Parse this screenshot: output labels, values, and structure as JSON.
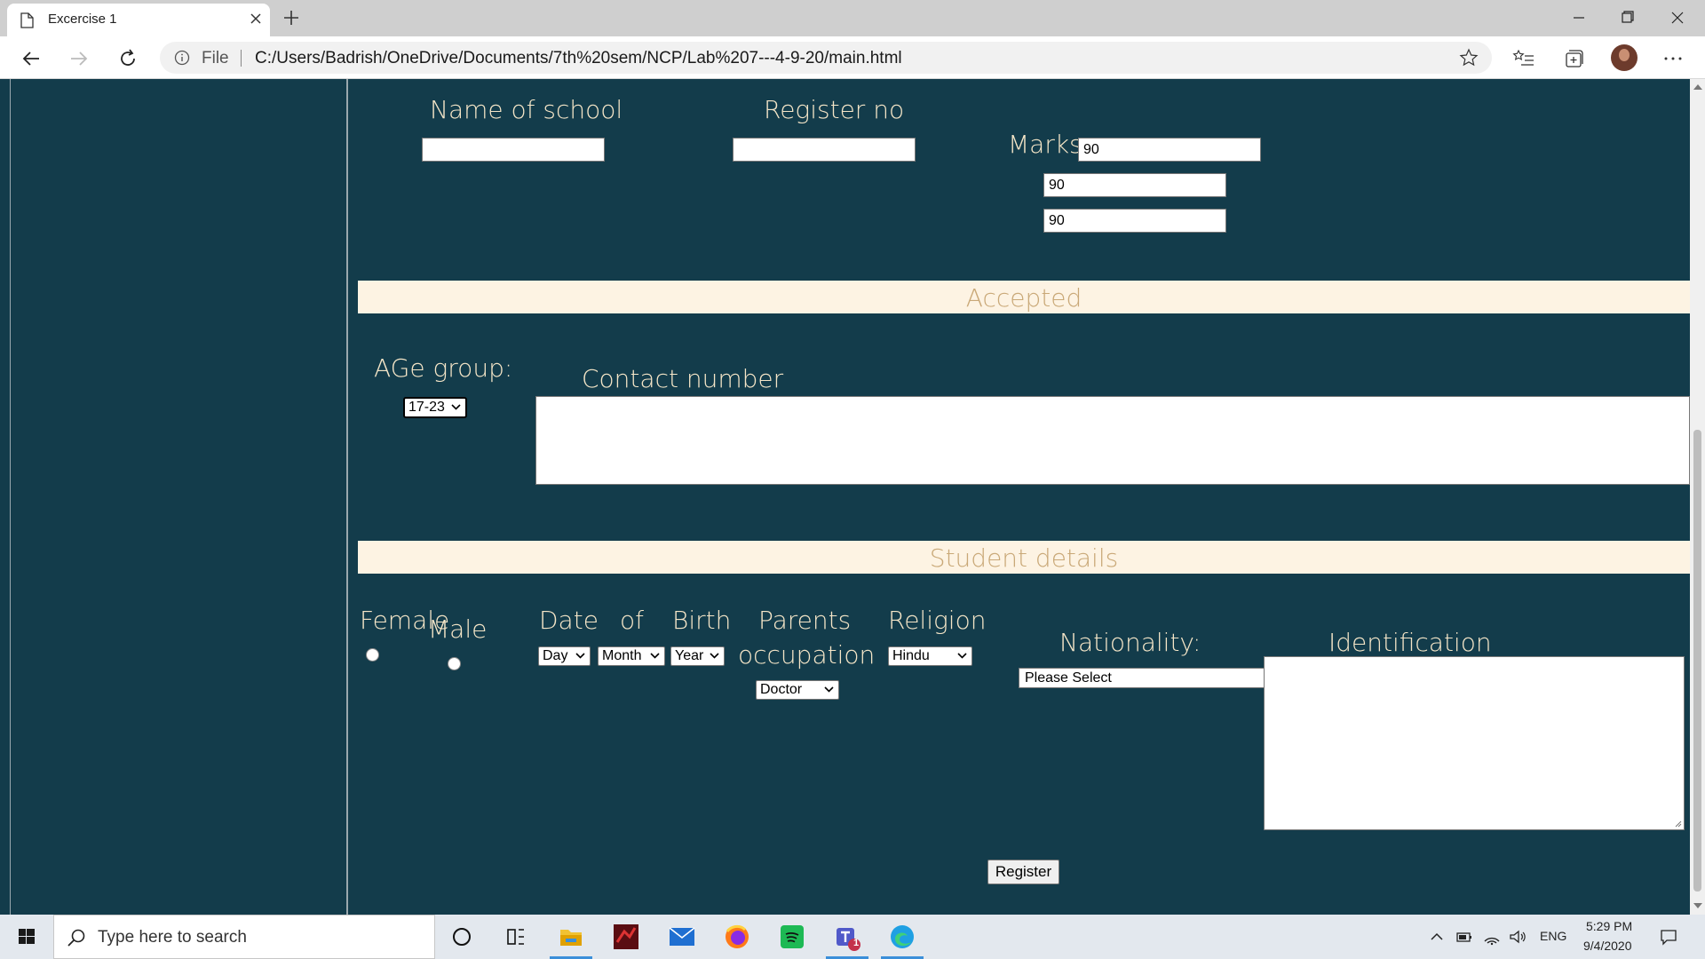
{
  "browser": {
    "tab_title": "Excercise 1",
    "address_prefix": "File",
    "url": "C:/Users/Badrish/OneDrive/Documents/7th%20sem/NCP/Lab%207---4-9-20/main.html"
  },
  "form": {
    "school_label": "Name of school",
    "school_value": "",
    "register_label": "Register no",
    "register_value": "",
    "marks_label": "Marks",
    "marks": [
      "90",
      "90",
      "90"
    ],
    "accepted_heading": "Accepted",
    "age_label": "AGe group:",
    "age_value": "17-23",
    "contact_label": "Contact number",
    "student_heading": "Student details",
    "female_label": "Female",
    "male_label": "Male",
    "dob_words": [
      "Date",
      "of",
      "Birth"
    ],
    "dob_day": "Day",
    "dob_month": "Month",
    "dob_year": "Year",
    "parents_label_1": "Parents",
    "parents_label_2": "occupation",
    "parents_value": "Doctor",
    "religion_label": "Religion",
    "religion_value": "Hindu",
    "nationality_label": "Nationality:",
    "nationality_value": "Please Select",
    "identification_label": "Identification",
    "register_button": "Register"
  },
  "taskbar": {
    "search_placeholder": "Type here to search",
    "teams_badge": "1",
    "language": "ENG",
    "time": "5:29 PM",
    "date": "9/4/2020"
  },
  "colors": {
    "page_bg": "#133c4b",
    "label": "#f5e6c8",
    "band_bg": "#fdf3e3",
    "band_text": "#c9a877"
  }
}
